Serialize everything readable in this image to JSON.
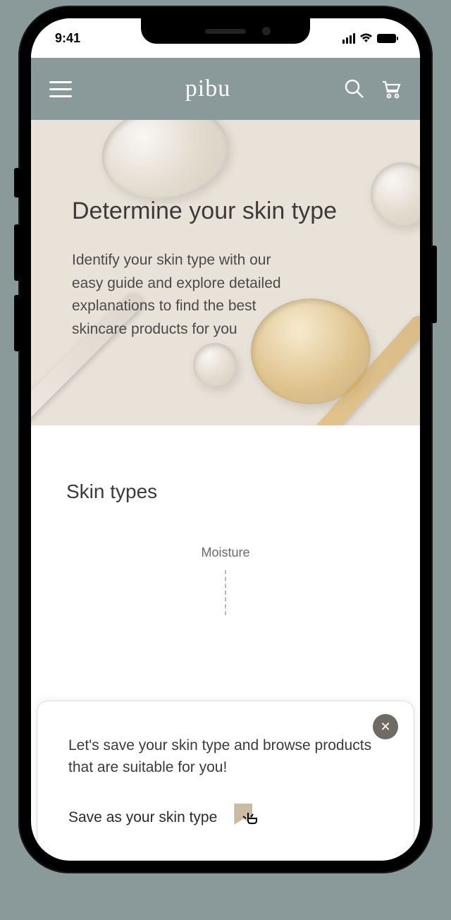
{
  "status": {
    "time": "9:41"
  },
  "header": {
    "brand": "pibu"
  },
  "hero": {
    "title": "Determine your skin type",
    "description": "Identify your skin type with our easy guide and explore detailed explanations to find the best skincare products for you"
  },
  "section": {
    "title": "Skin types",
    "axis_label": "Moisture"
  },
  "sheet": {
    "message": "Let's save your skin type and browse products that are suitable for you!",
    "action_label": "Save as your skin type",
    "close_glyph": "✕"
  }
}
